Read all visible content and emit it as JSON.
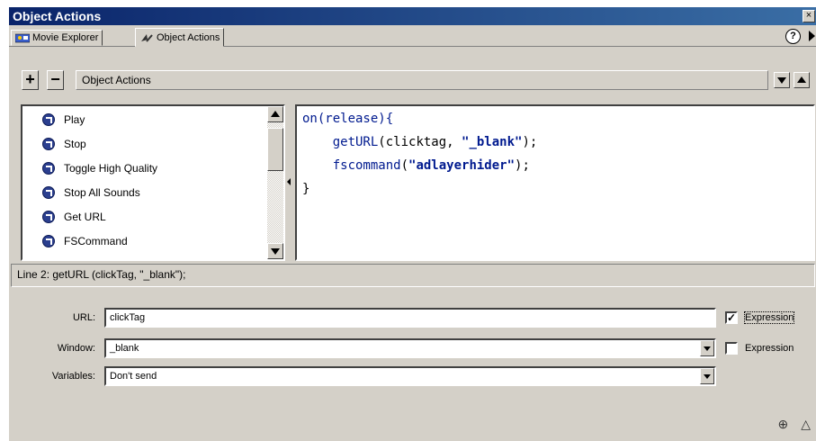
{
  "window": {
    "title": "Object Actions",
    "close_label": "×"
  },
  "tabs": [
    {
      "label": "Movie Explorer",
      "icon": "movie-explorer-icon"
    },
    {
      "label": "Object Actions",
      "icon": "object-actions-icon"
    }
  ],
  "help_label": "?",
  "toolbar": {
    "add_label": "+",
    "remove_label": "−",
    "path_label": "Object Actions"
  },
  "actions": [
    {
      "label": "Play",
      "icon": "action-icon"
    },
    {
      "label": "Stop",
      "icon": "action-icon"
    },
    {
      "label": "Toggle High Quality",
      "icon": "action-icon"
    },
    {
      "label": "Stop All Sounds",
      "icon": "action-icon"
    },
    {
      "label": "Get URL",
      "icon": "action-icon"
    },
    {
      "label": "FSCommand",
      "icon": "action-icon"
    }
  ],
  "code": {
    "line1": "on(release){",
    "line2_fn": "getURL",
    "line2_args": "(clicktag, ",
    "line2_str": "\"_blank\"",
    "line2_end": ");",
    "line3_fn": "fscommand",
    "line3_open": "(",
    "line3_str": "\"adlayerhider\"",
    "line3_end": ");",
    "line4": "}"
  },
  "status": {
    "text": "Line 2: getURL (clickTag, \"_blank\");"
  },
  "params": {
    "url_label": "URL:",
    "url_value": "clickTag",
    "url_expression_label": "Expression",
    "url_expression_checked": true,
    "window_label": "Window:",
    "window_value": "_blank",
    "window_expression_label": "Expression",
    "window_expression_checked": false,
    "variables_label": "Variables:",
    "variables_value": "Don't send"
  },
  "bottom": {
    "target_icon": "⊕",
    "collapse_icon": "△"
  },
  "colors": {
    "title_bar": "#0a246a",
    "panel": "#d4d0c8",
    "code_blue": "#001a8f"
  }
}
